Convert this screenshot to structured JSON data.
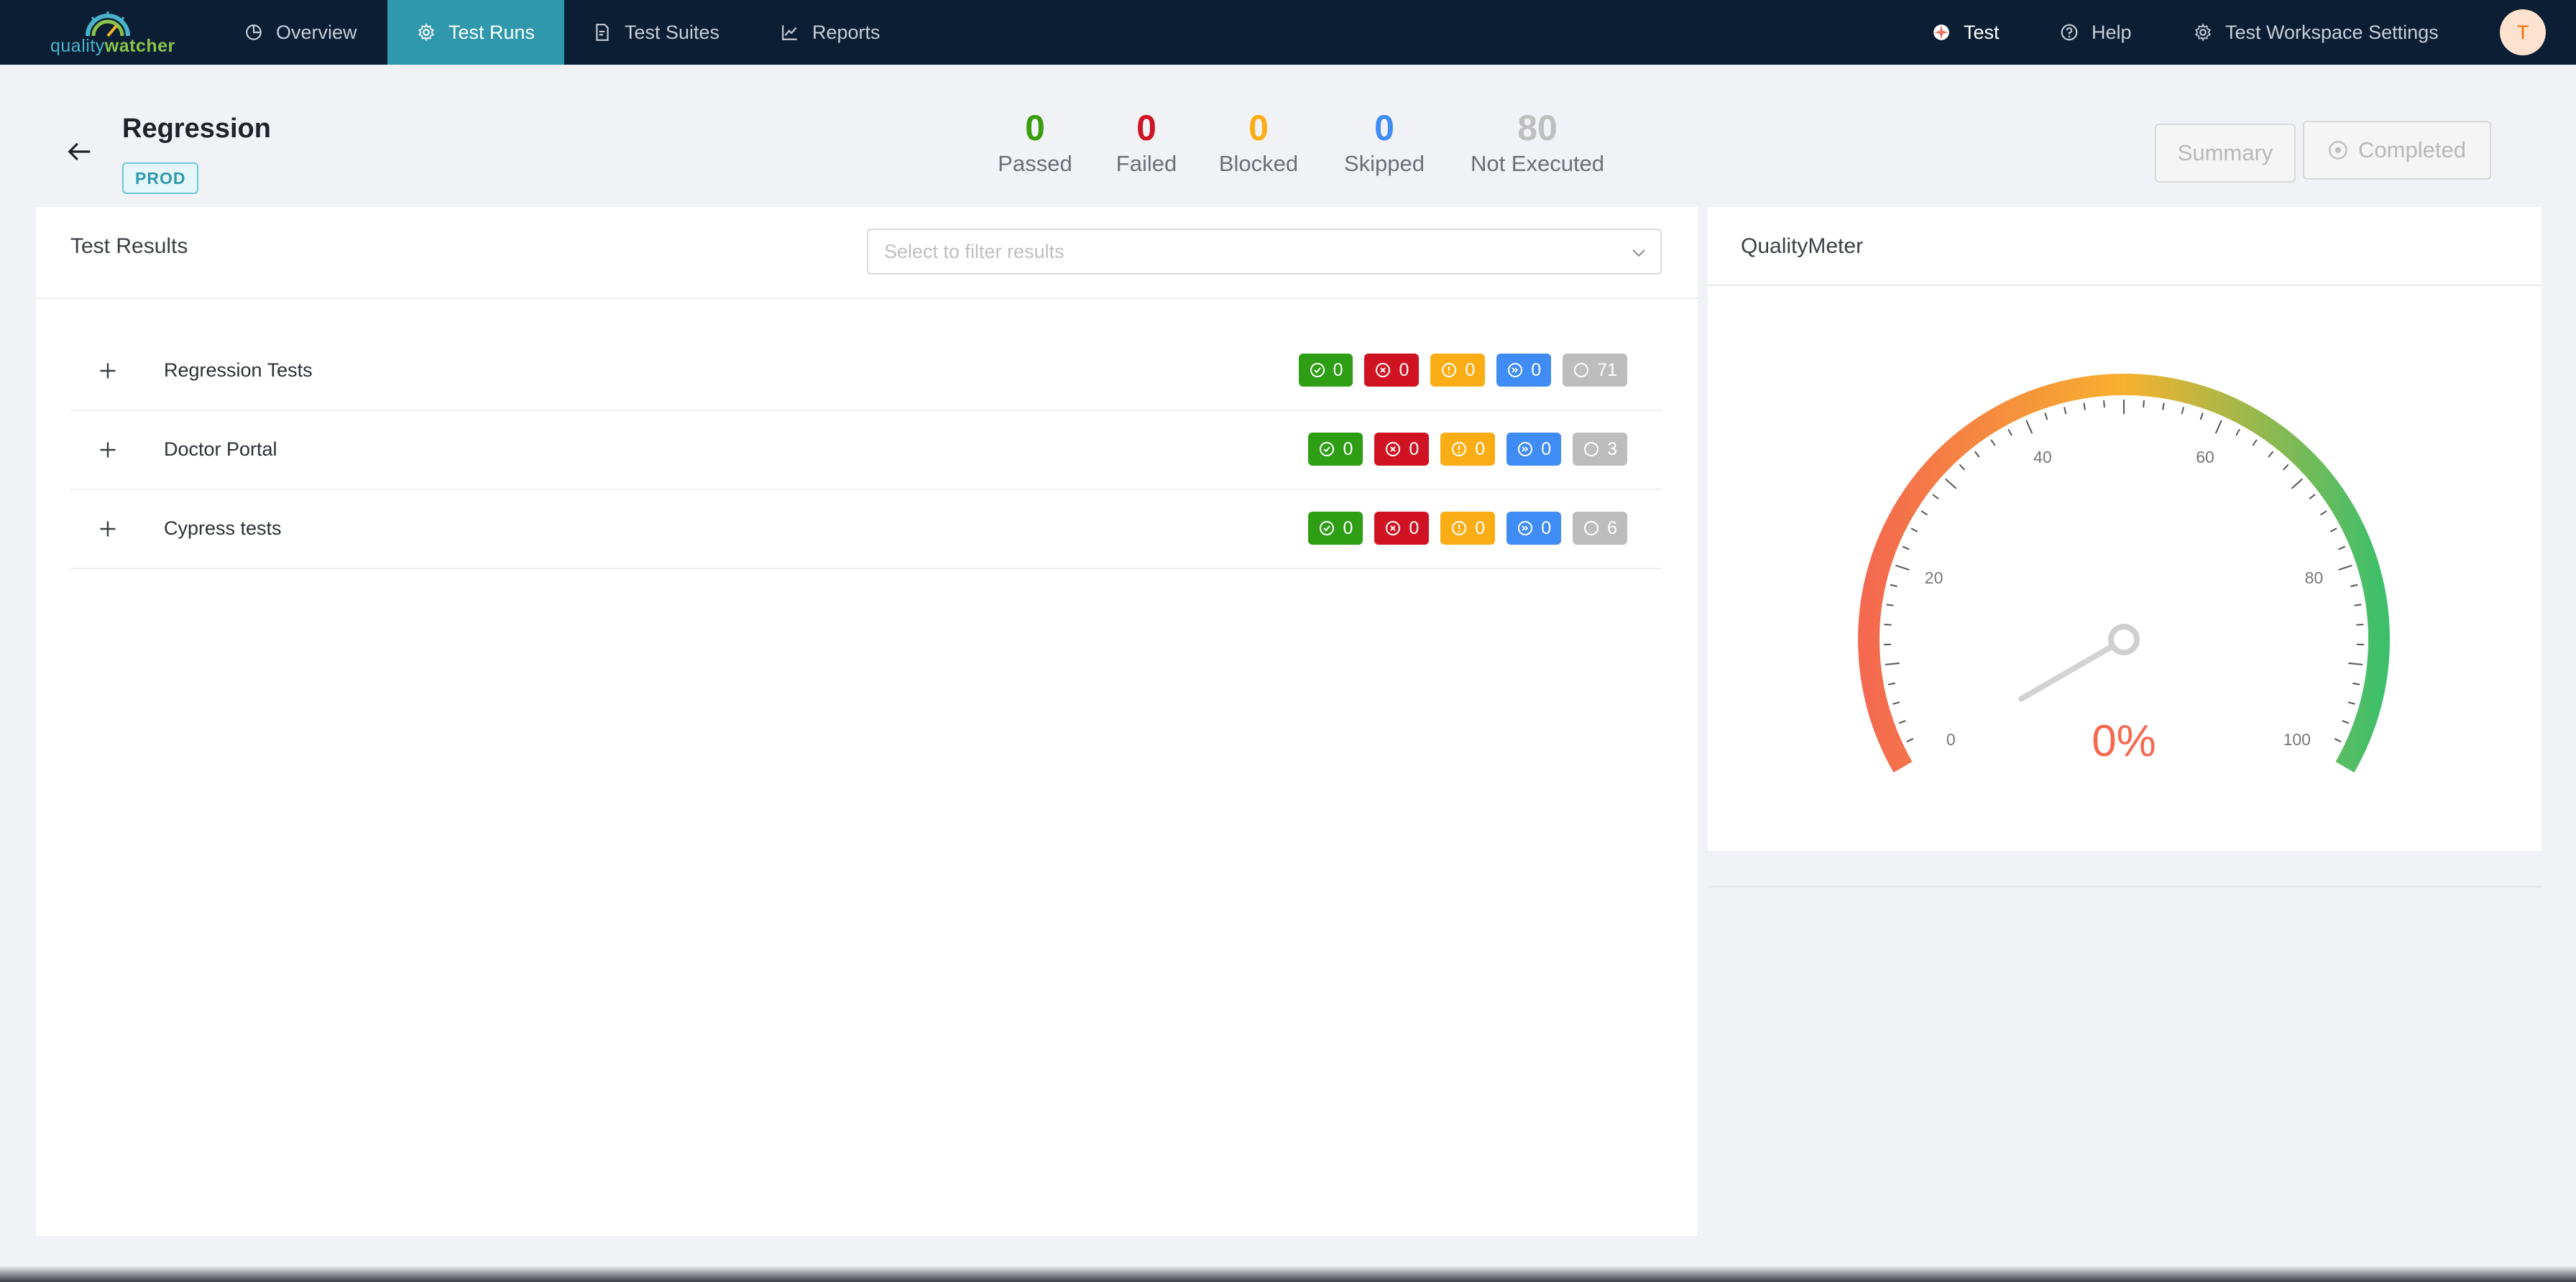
{
  "app": {
    "logo": {
      "part1": "quality",
      "part2": "watcher"
    },
    "nav": [
      {
        "label": "Overview",
        "icon": "pie-chart-icon"
      },
      {
        "label": "Test Runs",
        "icon": "gear-icon",
        "active": true
      },
      {
        "label": "Test Suites",
        "icon": "file-icon"
      },
      {
        "label": "Reports",
        "icon": "line-chart-icon"
      }
    ],
    "right_nav": {
      "workspace": "Test",
      "help": "Help",
      "settings": "Test Workspace Settings",
      "avatar_initial": "T"
    }
  },
  "run": {
    "title": "Regression",
    "env": "PROD",
    "stats": [
      {
        "value": "0",
        "label": "Passed",
        "color": "#389e0d"
      },
      {
        "value": "0",
        "label": "Failed",
        "color": "#cf1322"
      },
      {
        "value": "0",
        "label": "Blocked",
        "color": "#faad14"
      },
      {
        "value": "0",
        "label": "Skipped",
        "color": "#3f8cf5"
      },
      {
        "value": "80",
        "label": "Not Executed",
        "color": "#bfbfbf"
      }
    ],
    "summary_button": "Summary",
    "status_button": "Completed"
  },
  "results": {
    "title": "Test Results",
    "filter_placeholder": "Select to filter results",
    "suites": [
      {
        "name": "Regression Tests",
        "passed": "0",
        "failed": "0",
        "blocked": "0",
        "skipped": "0",
        "not_executed": "71"
      },
      {
        "name": "Doctor Portal",
        "passed": "0",
        "failed": "0",
        "blocked": "0",
        "skipped": "0",
        "not_executed": "3"
      },
      {
        "name": "Cypress tests",
        "passed": "0",
        "failed": "0",
        "blocked": "0",
        "skipped": "0",
        "not_executed": "6"
      }
    ]
  },
  "quality_meter": {
    "title": "QualityMeter",
    "value": 0,
    "display": "0%",
    "ticks": [
      "0",
      "20",
      "40",
      "60",
      "80",
      "100"
    ]
  }
}
